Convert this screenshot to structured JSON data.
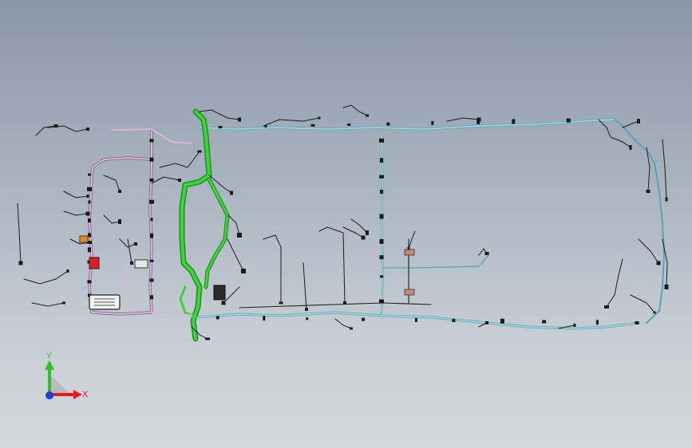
{
  "viewport": {
    "background_top": "#8a97a8",
    "background_bottom": "#d3d8dd"
  },
  "colors": {
    "main_trunk": "#3fd13f",
    "main_trunk_dark": "#1f8f1f",
    "frame_wire": "#a9d6e0",
    "frame_wire_dark": "#5aa3b5",
    "left_harness": "#d7b8d8",
    "left_harness_dark": "#7a5d85",
    "wire_black": "#1c1c1c",
    "connector_red": "#d62222",
    "connector_orange": "#e08a1f",
    "clip_tan": "#c08a7e"
  },
  "triad": {
    "y_label": "Y",
    "x_label": "X",
    "y_color": "#2fbf2f",
    "x_color": "#e02020",
    "z_color": "#1f3fd8",
    "icon": "coordinate-triad-icon"
  }
}
